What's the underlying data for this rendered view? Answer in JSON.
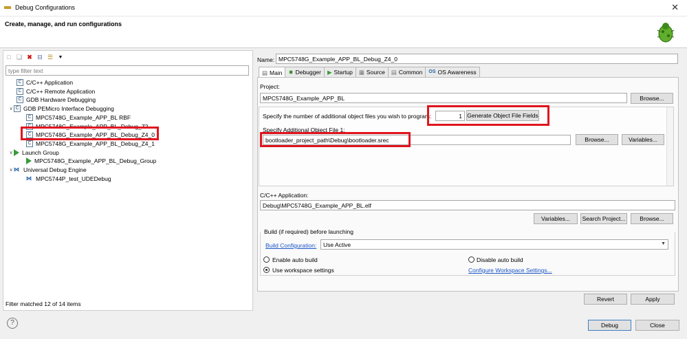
{
  "window": {
    "title": "Debug Configurations",
    "close_glyph": "✕"
  },
  "header": {
    "title": "Create, manage, and run configurations"
  },
  "left": {
    "filter_placeholder": "type filter text",
    "status": "Filter matched 12 of 14 items",
    "tree": [
      {
        "label": "C/C++ Application",
        "level": 1,
        "icon": "c-file-icon"
      },
      {
        "label": "C/C++ Remote Application",
        "level": 1,
        "icon": "c-file-icon"
      },
      {
        "label": "GDB Hardware Debugging",
        "level": 1,
        "icon": "c-file-icon"
      },
      {
        "label": "GDB PEMicro Interface Debugging",
        "level": 0,
        "icon": "c-file-icon",
        "expanded": true
      },
      {
        "label": "MPC5748G_Example_APP_BL RBF",
        "level": 2,
        "icon": "c-file-icon"
      },
      {
        "label": "MPC5748G_Example_APP_BL_Debug_Z2",
        "level": 2,
        "icon": "c-file-icon"
      },
      {
        "label": "MPC5748G_Example_APP_BL_Debug_Z4_0",
        "level": 2,
        "icon": "c-file-icon",
        "selected": true
      },
      {
        "label": "MPC5748G_Example_APP_BL_Debug_Z4_1",
        "level": 2,
        "icon": "c-file-icon"
      },
      {
        "label": "Launch Group",
        "level": 0,
        "icon": "launch-group-icon",
        "expanded": true
      },
      {
        "label": "MPC5748G_Example_APP_BL_Debug_Group",
        "level": 2,
        "icon": "launch-group-icon"
      },
      {
        "label": "Universal Debug Engine",
        "level": 0,
        "icon": "ude-icon",
        "expanded": true
      },
      {
        "label": "MPC5744P_test_UDEDebug",
        "level": 2,
        "icon": "ude-icon"
      }
    ]
  },
  "main": {
    "name_label": "Name:",
    "name_value": "MPC5748G_Example_APP_BL_Debug_Z4_0",
    "tabs": [
      "Main",
      "Debugger",
      "Startup",
      "Source",
      "Common",
      "OS Awareness"
    ],
    "project_label": "Project:",
    "project_value": "MPC5748G_Example_APP_BL",
    "browse": "Browse...",
    "object_files_label": "Specify the number of additional object files you wish to program:",
    "object_files_count": "1",
    "generate_button": "Generate Object File Fields",
    "additional_object_label": "Specify Additional Object File 1:",
    "additional_object_value": "bootloader_project_path\\Debug\\bootloader.srec",
    "variables": "Variables...",
    "app_label": "C/C++ Application:",
    "app_value": "Debug\\MPC5748G_Example_APP_BL.elf",
    "search_project": "Search Project...",
    "build_group_title": "Build (if required) before launching",
    "build_config_link": "Build Configuration:",
    "build_config_value": "Use Active",
    "enable_auto_build": "Enable auto build",
    "disable_auto_build": "Disable auto build",
    "use_workspace_settings": "Use workspace settings",
    "configure_workspace_link": "Configure Workspace Settings...",
    "revert": "Revert",
    "apply": "Apply"
  },
  "footer": {
    "help_glyph": "?",
    "debug": "Debug",
    "close": "Close"
  }
}
